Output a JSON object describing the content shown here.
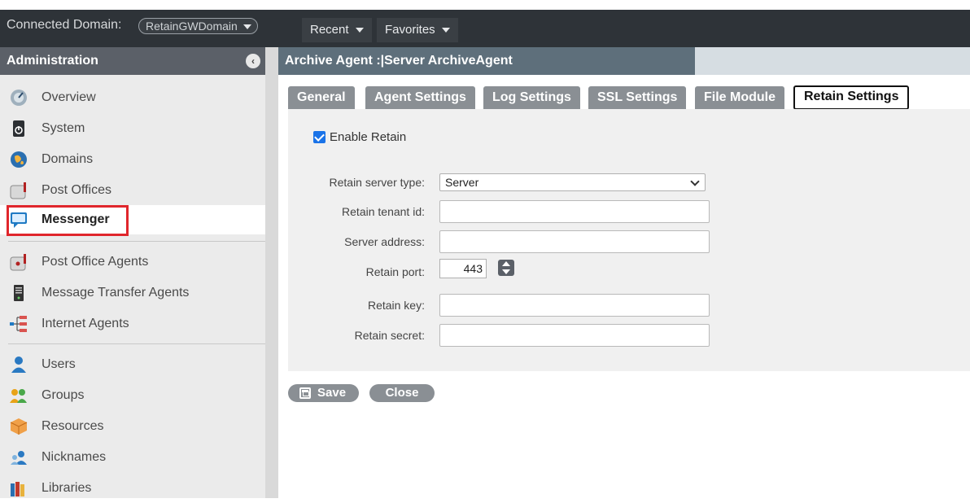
{
  "topbar": {
    "connected_label": "Connected Domain:",
    "domain_value": "RetainGWDomain",
    "recent_label": "Recent",
    "favorites_label": "Favorites"
  },
  "sidebar": {
    "header": "Administration",
    "collapse_icon": "chevron-left-icon",
    "items": [
      {
        "label": "Overview",
        "icon": "gauge-icon"
      },
      {
        "label": "System",
        "icon": "power-icon"
      },
      {
        "label": "Domains",
        "icon": "globe-icon"
      },
      {
        "label": "Post Offices",
        "icon": "mailbox-icon"
      },
      {
        "label": "Messenger",
        "icon": "speech-bubble-icon",
        "selected": true
      },
      {
        "label": "Post Office Agents",
        "icon": "post-office-agent-icon"
      },
      {
        "label": "Message Transfer Agents",
        "icon": "server-tower-icon"
      },
      {
        "label": "Internet Agents",
        "icon": "network-tree-icon"
      },
      {
        "label": "Users",
        "icon": "user-icon"
      },
      {
        "label": "Groups",
        "icon": "group-icon"
      },
      {
        "label": "Resources",
        "icon": "box-icon"
      },
      {
        "label": "Nicknames",
        "icon": "nickname-icon"
      },
      {
        "label": "Libraries",
        "icon": "books-icon"
      }
    ]
  },
  "main": {
    "title": "Archive Agent :|Server  ArchiveAgent",
    "tabs": [
      "General",
      "Agent Settings",
      "Log Settings",
      "SSL Settings",
      "File Module",
      "Retain Settings"
    ],
    "active_tab": "Retain Settings",
    "enable_retain_label": "Enable Retain",
    "enable_retain_checked": true,
    "fields": {
      "server_type_label": "Retain server type:",
      "server_type_value": "Server",
      "tenant_id_label": "Retain tenant id:",
      "tenant_id_value": "",
      "server_address_label": "Server address:",
      "server_address_value": "",
      "port_label": "Retain port:",
      "port_value": "443",
      "key_label": "Retain key:",
      "key_value": "",
      "secret_label": "Retain secret:",
      "secret_value": ""
    },
    "save_label": "Save",
    "close_label": "Close"
  },
  "colors": {
    "highlight": "#e0262c",
    "header_dark": "#2e3338",
    "tab_bg": "#8a8f94"
  }
}
